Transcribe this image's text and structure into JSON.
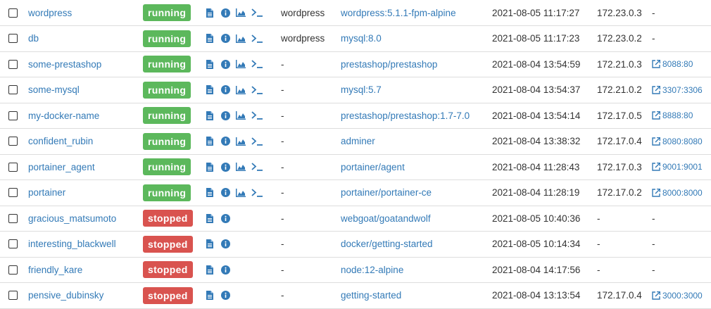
{
  "colors": {
    "link": "#337ab7",
    "running": "#5cb85c",
    "stopped": "#d9534f"
  },
  "icons": [
    "logs-icon",
    "inspect-icon",
    "stats-icon",
    "console-icon",
    "external-link-icon",
    "checkbox"
  ],
  "containers": [
    {
      "name": "wordpress",
      "status": "running",
      "stack": "wordpress",
      "image": "wordpress:5.1.1-fpm-alpine",
      "created": "2021-08-05 11:17:27",
      "ip": "172.23.0.3",
      "ports": "-"
    },
    {
      "name": "db",
      "status": "running",
      "stack": "wordpress",
      "image": "mysql:8.0",
      "created": "2021-08-05 11:17:23",
      "ip": "172.23.0.2",
      "ports": "-"
    },
    {
      "name": "some-prestashop",
      "status": "running",
      "stack": "-",
      "image": "prestashop/prestashop",
      "created": "2021-08-04 13:54:59",
      "ip": "172.21.0.3",
      "ports": "8088:80"
    },
    {
      "name": "some-mysql",
      "status": "running",
      "stack": "-",
      "image": "mysql:5.7",
      "created": "2021-08-04 13:54:37",
      "ip": "172.21.0.2",
      "ports": "3307:3306"
    },
    {
      "name": "my-docker-name",
      "status": "running",
      "stack": "-",
      "image": "prestashop/prestashop:1.7-7.0",
      "created": "2021-08-04 13:54:14",
      "ip": "172.17.0.5",
      "ports": "8888:80"
    },
    {
      "name": "confident_rubin",
      "status": "running",
      "stack": "-",
      "image": "adminer",
      "created": "2021-08-04 13:38:32",
      "ip": "172.17.0.4",
      "ports": "8080:8080"
    },
    {
      "name": "portainer_agent",
      "status": "running",
      "stack": "-",
      "image": "portainer/agent",
      "created": "2021-08-04 11:28:43",
      "ip": "172.17.0.3",
      "ports": "9001:9001"
    },
    {
      "name": "portainer",
      "status": "running",
      "stack": "-",
      "image": "portainer/portainer-ce",
      "created": "2021-08-04 11:28:19",
      "ip": "172.17.0.2",
      "ports": "8000:8000"
    },
    {
      "name": "gracious_matsumoto",
      "status": "stopped",
      "stack": "-",
      "image": "webgoat/goatandwolf",
      "created": "2021-08-05 10:40:36",
      "ip": "-",
      "ports": "-"
    },
    {
      "name": "interesting_blackwell",
      "status": "stopped",
      "stack": "-",
      "image": "docker/getting-started",
      "created": "2021-08-05 10:14:34",
      "ip": "-",
      "ports": "-"
    },
    {
      "name": "friendly_kare",
      "status": "stopped",
      "stack": "-",
      "image": "node:12-alpine",
      "created": "2021-08-04 14:17:56",
      "ip": "-",
      "ports": "-"
    },
    {
      "name": "pensive_dubinsky",
      "status": "stopped",
      "stack": "-",
      "image": "getting-started",
      "created": "2021-08-04 13:13:54",
      "ip": "172.17.0.4",
      "ports": "3000:3000"
    }
  ]
}
